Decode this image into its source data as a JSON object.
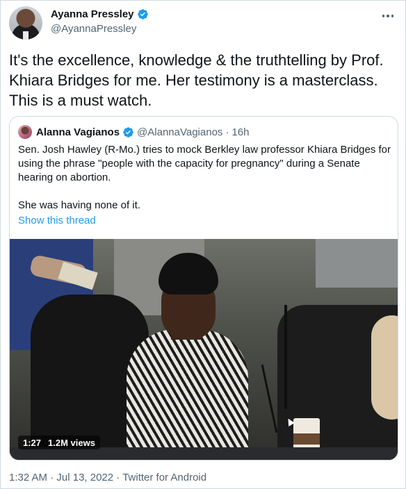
{
  "author": {
    "name": "Ayanna Pressley",
    "handle": "@AyannaPressley",
    "verified_icon": "verified-badge-icon"
  },
  "tweet": {
    "text": "It's the excellence, knowledge & the truthtelling by Prof. Khiara Bridges for me. Her testimony is a masterclass. This is a must watch."
  },
  "quoted": {
    "name": "Alanna Vagianos",
    "handle": "@AlannaVagianos",
    "separator": "·",
    "age": "16h",
    "text_1": "Sen. Josh Hawley (R-Mo.) tries to mock Berkley law professor Khiara Bridges for using the phrase \"people with the capacity for pregnancy\" during a Senate hearing on abortion.",
    "text_2": "She was having none of it.",
    "show_thread": "Show this thread",
    "video": {
      "duration": "1:27",
      "views": "1.2M views"
    }
  },
  "meta": {
    "time": "1:32 AM",
    "separator": "·",
    "date": "Jul 13, 2022",
    "source": "Twitter for Android"
  },
  "colors": {
    "accent": "#1d9bf0",
    "secondary_text": "#536471",
    "border": "#cfd9de"
  }
}
